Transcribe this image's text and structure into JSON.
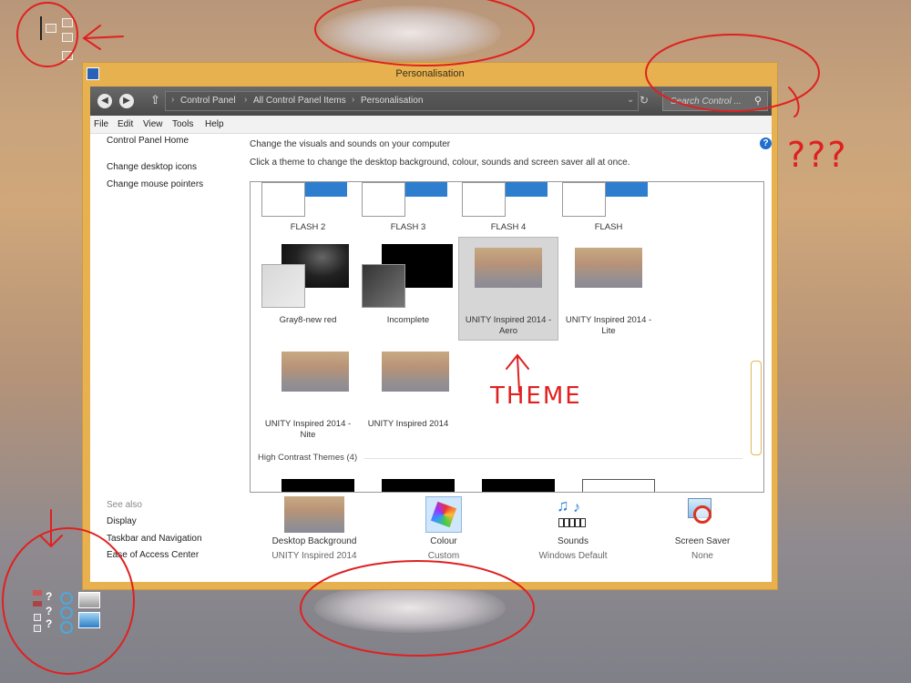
{
  "window": {
    "title": "Personalisation",
    "address": [
      "Control Panel",
      "All Control Panel Items",
      "Personalisation"
    ],
    "search_placeholder": "Search Control ...",
    "menu": [
      "File",
      "Edit",
      "View",
      "Tools",
      "Help"
    ]
  },
  "sidebar": {
    "home": "Control Panel Home",
    "links": [
      "Change desktop icons",
      "Change mouse pointers"
    ],
    "see_also_title": "See also",
    "see_also": [
      "Display",
      "Taskbar and Navigation",
      "Ease of Access Center"
    ]
  },
  "main": {
    "heading": "Change the visuals and sounds on your computer",
    "subheading": "Click a theme to change the desktop background, colour, sounds and screen saver all at once.",
    "themes_row1": [
      "FLASH 2",
      "FLASH 3",
      "FLASH 4",
      "FLASH"
    ],
    "themes_row2": [
      "Gray8-new red",
      "Incomplete",
      "UNITY Inspired 2014 - Aero",
      "UNITY Inspired 2014 - Lite"
    ],
    "themes_row3": [
      "UNITY Inspired 2014 - Nite",
      "UNITY Inspired 2014"
    ],
    "high_contrast_title": "High Contrast Themes (4)",
    "selected_theme": "UNITY Inspired 2014 - Aero"
  },
  "bottom": [
    {
      "label": "Desktop Background",
      "value": "UNITY Inspired 2014",
      "icon": "desktop-background-icon"
    },
    {
      "label": "Colour",
      "value": "Custom",
      "icon": "colour-palette-icon"
    },
    {
      "label": "Sounds",
      "value": "Windows Default",
      "icon": "music-notes-icon"
    },
    {
      "label": "Screen Saver",
      "value": "None",
      "icon": "screen-saver-icon"
    }
  ],
  "annotations": {
    "question": "???",
    "theme": "THEME"
  },
  "colors": {
    "window_frame": "#e7b14f",
    "nav_bar": "#555555",
    "annotation_red": "#e02020",
    "selection": "#d6d6d6"
  }
}
